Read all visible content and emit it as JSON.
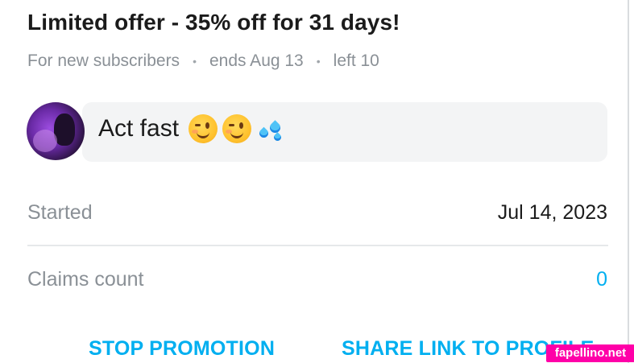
{
  "offer": {
    "title": "Limited offer - 35% off for 31 days!",
    "audience": "For new subscribers",
    "ends": "ends Aug 13",
    "left": "left 10",
    "separator": "•"
  },
  "message": {
    "text": "Act fast",
    "emojis": [
      "winking-face",
      "winking-face",
      "sweat-droplets"
    ]
  },
  "details": {
    "started_label": "Started",
    "started_value": "Jul 14, 2023",
    "claims_label": "Claims count",
    "claims_value": "0"
  },
  "actions": {
    "stop_label": "STOP PROMOTION",
    "share_label": "SHARE LINK TO PROFILE"
  },
  "watermark": "fapellino.net",
  "colors": {
    "accent": "#00aff0",
    "muted_text": "#8a9096",
    "bubble_bg": "#f3f4f5",
    "watermark_bg": "#ff00a8"
  }
}
